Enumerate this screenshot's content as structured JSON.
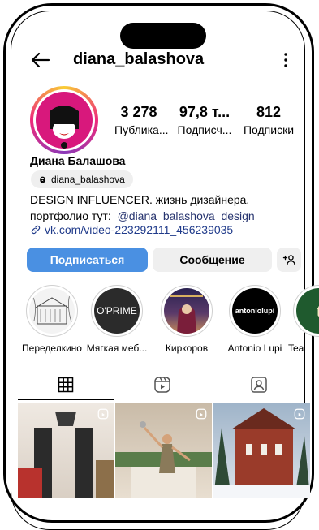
{
  "header": {
    "username": "diana_balashova"
  },
  "stats": [
    {
      "value": "3 278",
      "label": "Публика..."
    },
    {
      "value": "97,8 т...",
      "label": "Подписч..."
    },
    {
      "value": "812",
      "label": "Подписки"
    }
  ],
  "profile": {
    "name": "Диана Балашова",
    "threads_handle": "diana_balashova",
    "bio_line1": "DESIGN INFLUENCER.  жизнь дизайнера.",
    "bio_line2_prefix": "портфолио тут:  ",
    "bio_line2_mention": "@diana_balashova_design",
    "link": "vk.com/video-223292111_456239035"
  },
  "actions": {
    "follow": "Подписаться",
    "message": "Сообщение"
  },
  "highlights": [
    {
      "label": "Переделкино",
      "logo": ""
    },
    {
      "label": "Мягкая меб...",
      "logo": "O'PRIME"
    },
    {
      "label": "Киркоров",
      "logo": ""
    },
    {
      "label": "Antonio Lupi",
      "logo": "antoniolupi"
    },
    {
      "label": "Tea",
      "logo": "t"
    }
  ],
  "tabs": [
    "grid-icon",
    "reels-icon",
    "tagged-icon"
  ],
  "colors": {
    "follow": "#4a90e2",
    "secondary": "#efefef",
    "link": "#1f3a8a"
  }
}
